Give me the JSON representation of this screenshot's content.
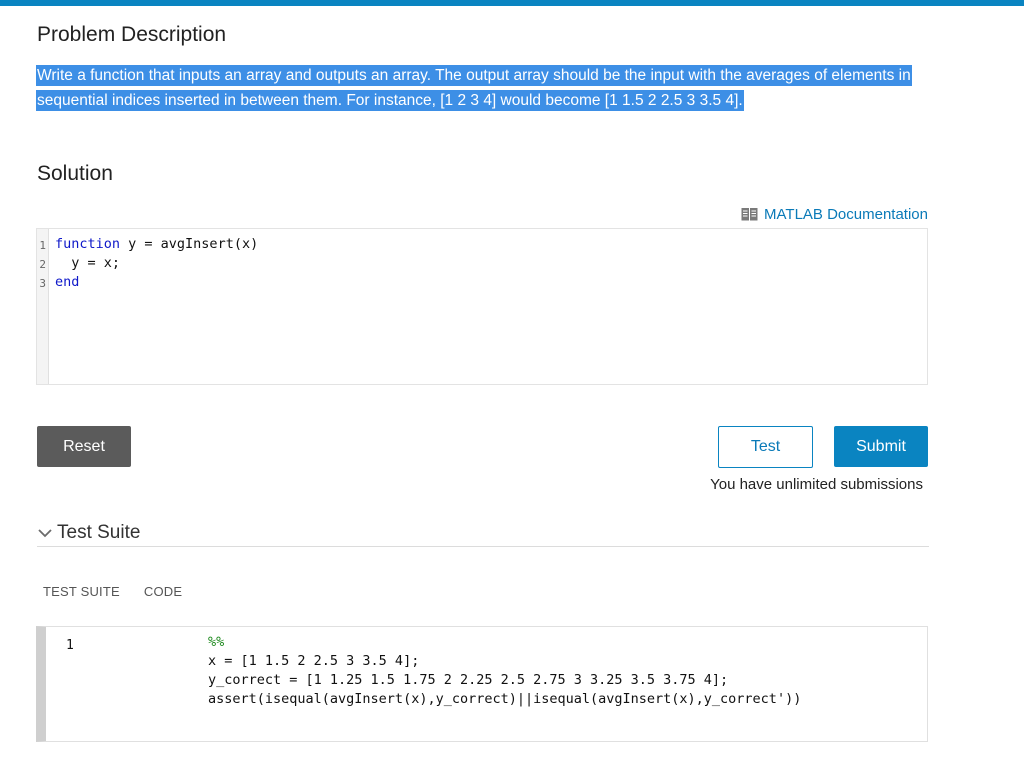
{
  "problem": {
    "title": "Problem Description",
    "description": "Write a function that inputs an array and outputs an array. The output array should be the input with the averages of elements in sequential indices inserted in between them. For instance, [1 2 3 4] would become [1 1.5 2 2.5 3 3.5 4]."
  },
  "solution": {
    "title": "Solution",
    "doc_link": "MATLAB Documentation",
    "doc_icon": "book-icon",
    "lines": [
      {
        "num": "1",
        "kw": "function",
        "rest": " y = avgInsert(x)"
      },
      {
        "num": "2",
        "kw": "",
        "rest": "  y = x;"
      },
      {
        "num": "3",
        "kw": "end",
        "rest": ""
      }
    ]
  },
  "actions": {
    "reset": "Reset",
    "test": "Test",
    "submit": "Submit",
    "submissions_note": "You have unlimited submissions"
  },
  "test_suite": {
    "title": "Test Suite",
    "tabs": [
      "TEST SUITE",
      "CODE"
    ],
    "tests": [
      {
        "number": "1",
        "comment": "%%",
        "code": [
          "x = [1 1.5 2 2.5 3 3.5 4];",
          "y_correct = [1 1.25 1.5 1.75 2 2.25 2.5 2.75 3 3.25 3.5 3.75 4];",
          "assert(isequal(avgInsert(x),y_correct)||isequal(avgInsert(x),y_correct'))"
        ]
      }
    ]
  },
  "colors": {
    "accent": "#0a84c1",
    "selection": "#3d8fe6",
    "reset_button": "#5b5b5b",
    "keyword": "#0e18c9",
    "comment": "#1e8a1e"
  }
}
